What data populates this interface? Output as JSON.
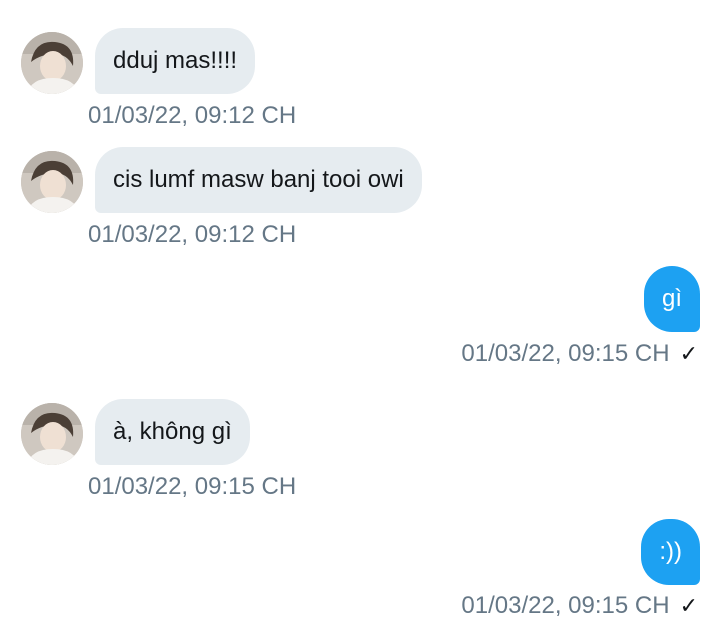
{
  "messages": [
    {
      "direction": "incoming",
      "text": "dduj mas!!!!",
      "timestamp": "01/03/22, 09:12 CH"
    },
    {
      "direction": "incoming",
      "text": "cis lumf masw banj tooi owi",
      "timestamp": "01/03/22, 09:12 CH"
    },
    {
      "direction": "outgoing",
      "text": "gì",
      "timestamp": "01/03/22, 09:15 CH",
      "status_icon": "checkmark-icon",
      "status_glyph": "✓"
    },
    {
      "direction": "incoming",
      "text": "à, không gì",
      "timestamp": "01/03/22, 09:15 CH"
    },
    {
      "direction": "outgoing",
      "text": ":))",
      "timestamp": "01/03/22, 09:15 CH",
      "status_icon": "checkmark-icon",
      "status_glyph": "✓"
    }
  ],
  "colors": {
    "incoming_bubble": "#e6ecf0",
    "outgoing_bubble": "#1da1f2",
    "timestamp_text": "#657786"
  }
}
